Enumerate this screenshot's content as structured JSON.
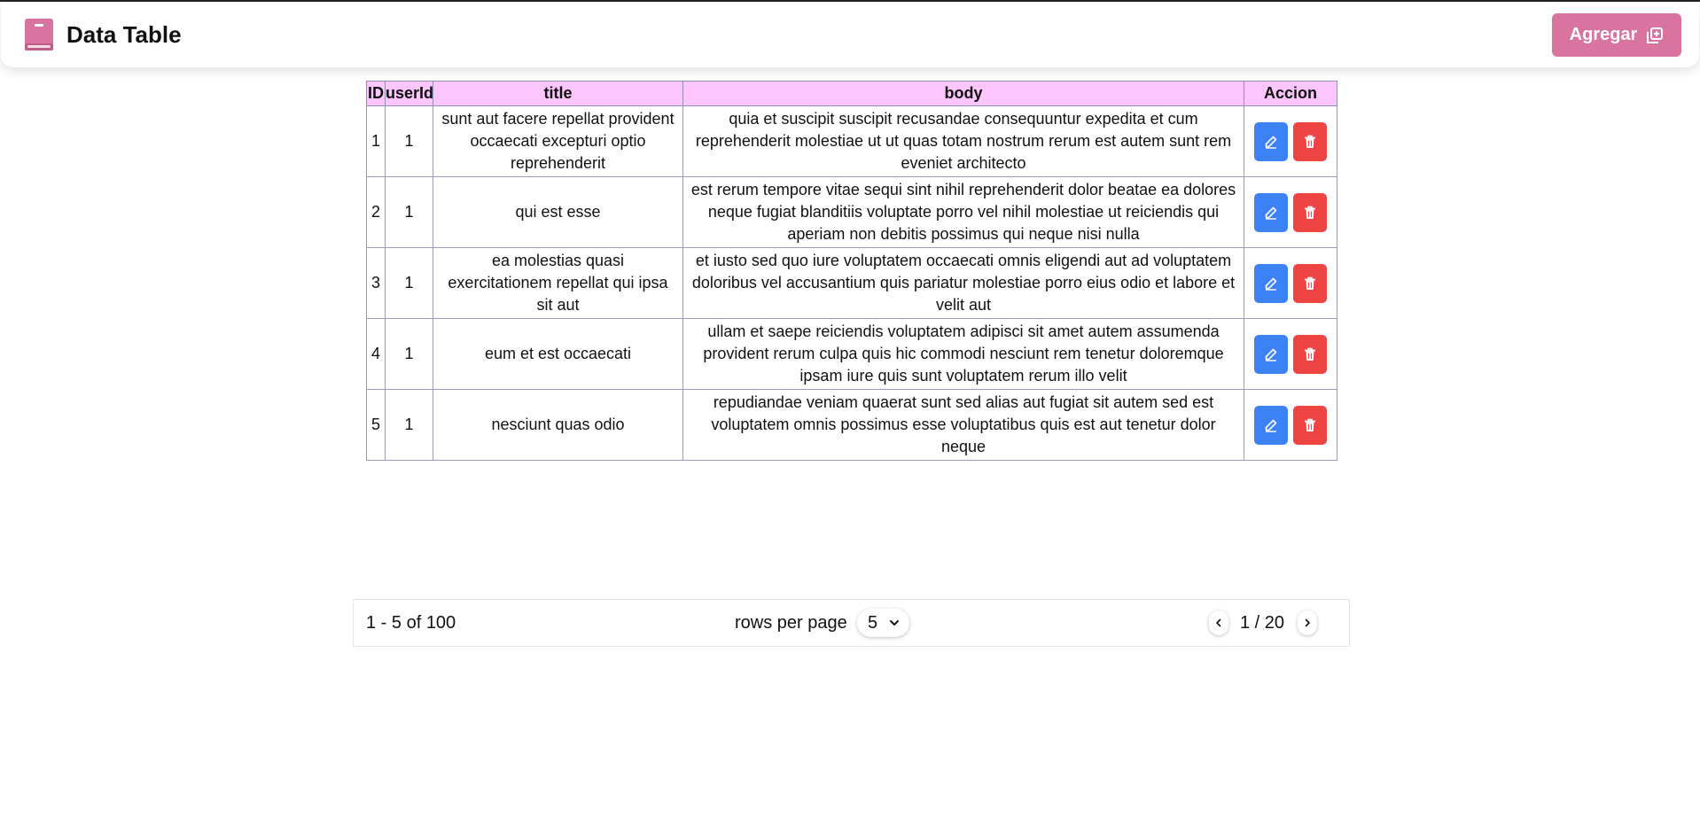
{
  "header": {
    "title": "Data Table",
    "add_label": "Agregar",
    "brand_color": "#d9739f"
  },
  "table": {
    "columns": [
      "ID",
      "userId",
      "title",
      "body",
      "Accion"
    ],
    "rows": [
      {
        "id": "1",
        "userId": "1",
        "title": "sunt aut facere repellat provident occaecati excepturi optio reprehenderit",
        "body": "quia et suscipit suscipit recusandae consequuntur expedita et cum reprehenderit molestiae ut ut quas totam nostrum rerum est autem sunt rem eveniet architecto"
      },
      {
        "id": "2",
        "userId": "1",
        "title": "qui est esse",
        "body": "est rerum tempore vitae sequi sint nihil reprehenderit dolor beatae ea dolores neque fugiat blanditiis voluptate porro vel nihil molestiae ut reiciendis qui aperiam non debitis possimus qui neque nisi nulla"
      },
      {
        "id": "3",
        "userId": "1",
        "title": "ea molestias quasi exercitationem repellat qui ipsa sit aut",
        "body": "et iusto sed quo iure voluptatem occaecati omnis eligendi aut ad voluptatem doloribus vel accusantium quis pariatur molestiae porro eius odio et labore et velit aut"
      },
      {
        "id": "4",
        "userId": "1",
        "title": "eum et est occaecati",
        "body": "ullam et saepe reiciendis voluptatem adipisci sit amet autem assumenda provident rerum culpa quis hic commodi nesciunt rem tenetur doloremque ipsam iure quis sunt voluptatem rerum illo velit"
      },
      {
        "id": "5",
        "userId": "1",
        "title": "nesciunt quas odio",
        "body": "repudiandae veniam quaerat sunt sed alias aut fugiat sit autem sed est voluptatem omnis possimus esse voluptatibus quis est aut tenetur dolor neque"
      }
    ],
    "header_bg": "#fcc5fc",
    "edit_color": "#3b82f6",
    "delete_color": "#ef4444"
  },
  "pagination": {
    "range_text": "1 - 5 of 100",
    "rows_per_page_label": "rows per page",
    "rows_per_page_value": "5",
    "page_text": "1 / 20"
  },
  "icons": {
    "brand": "book-icon",
    "add": "add-copy-icon",
    "edit": "pencil-icon",
    "delete": "trash-icon",
    "select": "chevron-down-icon",
    "prev": "chevron-left-icon",
    "next": "chevron-right-icon"
  }
}
